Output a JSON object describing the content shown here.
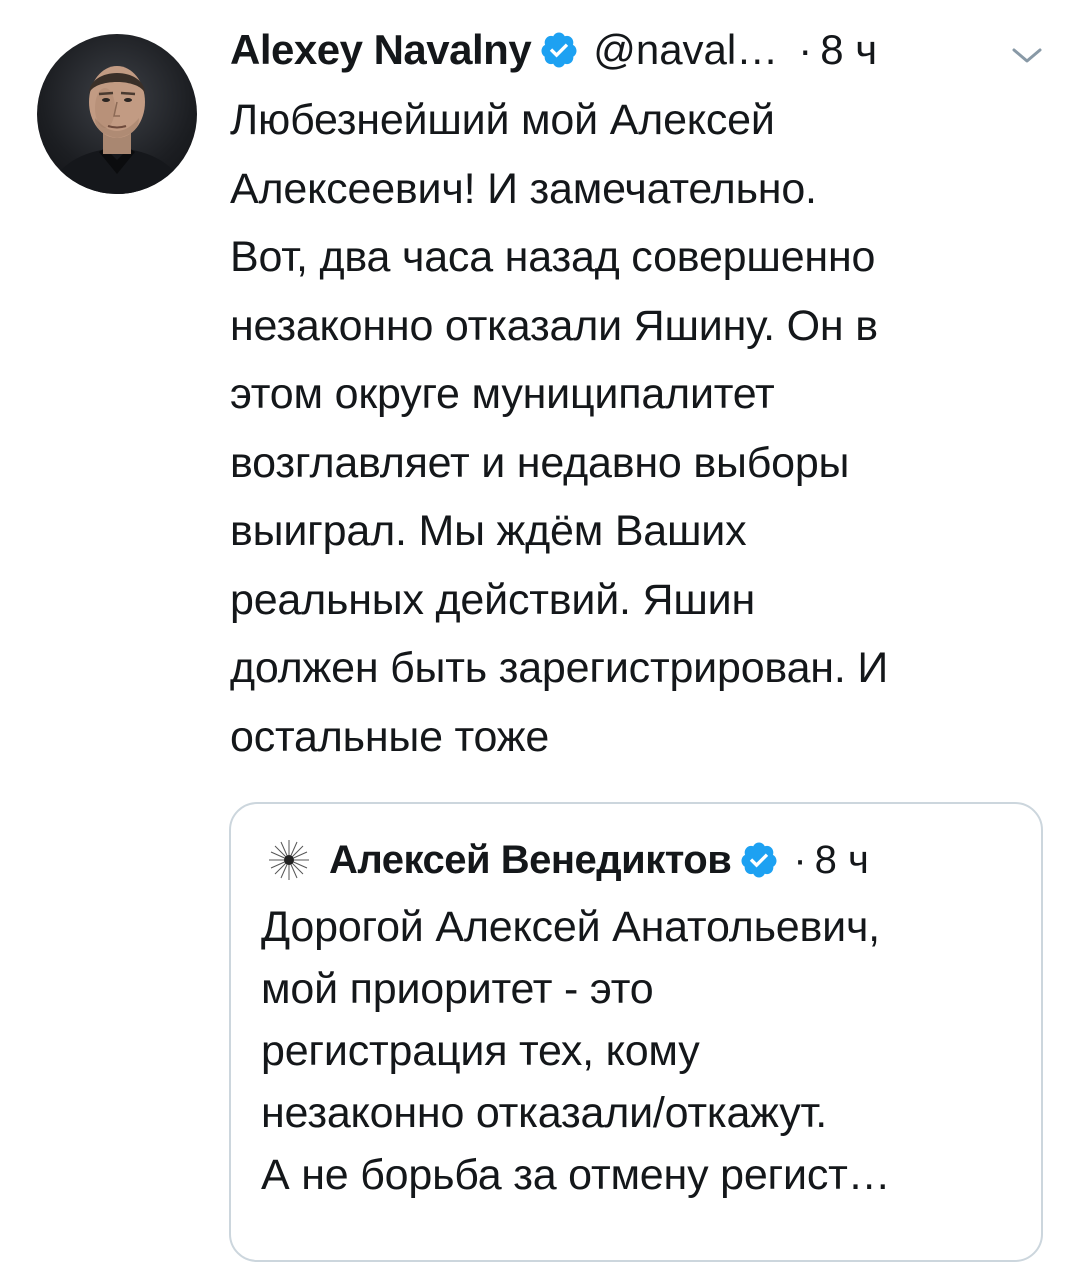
{
  "tweet": {
    "display_name": "Alexey Navalny",
    "handle": "@naval…",
    "separator": "·",
    "time": "8 ч",
    "text": "Любезнейший мой Алексей\nАлексеевич! И замечательно.\nВот, два часа назад совершенно\nнезаконно отказали Яшину. Он в\nэтом округе муниципалитет\nвозглавляет и недавно выборы\nвыиграл. Мы ждём Ваших\nреальных действий. Яшин\nдолжен быть зарегистрирован. И\nостальные тоже",
    "icons": {
      "avatar": "avatar-photo",
      "verified": "verified-badge-icon",
      "menu": "chevron-down-icon"
    }
  },
  "quoted_tweet": {
    "display_name": "Алексей Венедиктов",
    "separator": "·",
    "time": "8 ч",
    "text": "Дорогой Алексей Анатольевич,\nмой приоритет - это\nрегистрация тех, кому\nнезаконно отказали/откажут.\nА не борьба за отмену регист…",
    "icons": {
      "avatar": "dandelion-avatar",
      "verified": "verified-badge-icon"
    }
  },
  "colors": {
    "verified": "#1da1f2",
    "text": "#14171a",
    "border": "#ccd6dd",
    "chevron": "#8899a6"
  }
}
